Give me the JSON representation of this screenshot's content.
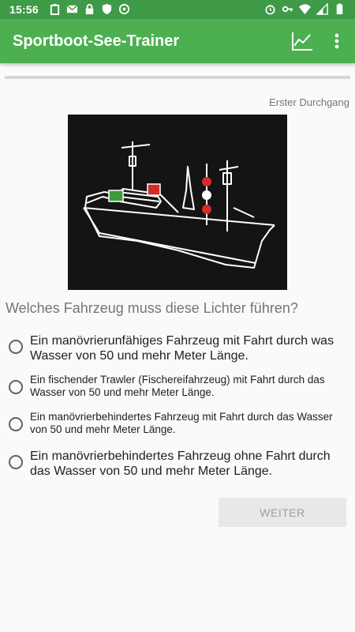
{
  "status_bar": {
    "time": "15:56",
    "left_icons": [
      "clipboard-icon",
      "mail-icon",
      "lock-icon",
      "shield-icon",
      "sync-icon"
    ],
    "right_icons": [
      "alarm-icon",
      "key-icon",
      "wifi-icon",
      "signal-icon",
      "battery-icon"
    ]
  },
  "app_bar": {
    "title": "Sportboot-See-Trainer",
    "actions": [
      "chart-icon",
      "more-vert-icon"
    ]
  },
  "colors": {
    "status_bar": "#3e9a46",
    "app_bar": "#4caf50",
    "background": "#fafafa"
  },
  "progress": {
    "value": 0.0
  },
  "round_label": "Erster Durchgang",
  "question": {
    "text": "Welches Fahrzeug muss diese Lichter führen?",
    "options": [
      "Ein manövrierunfähiges Fahrzeug mit Fahrt durch was Wasser von 50 und mehr Meter Länge.",
      "Ein fischender Trawler (Fischereifahrzeug) mit Fahrt durch das Wasser von 50 und mehr Meter Länge.",
      "Ein manövrierbehindertes Fahrzeug mit Fahrt durch das Wasser von 50 und mehr Meter Länge.",
      "Ein manövrierbehindertes Fahrzeug ohne Fahrt durch das Wasser von 50 und mehr Meter Länge."
    ]
  },
  "next_button": {
    "label": "WEITER"
  }
}
